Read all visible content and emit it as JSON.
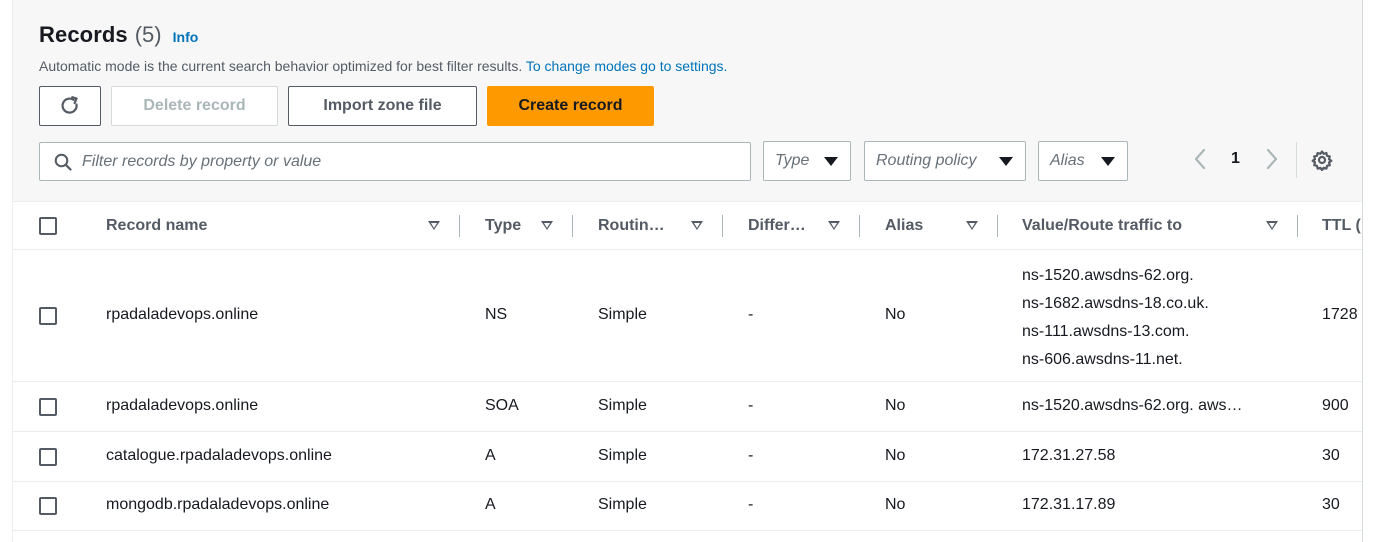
{
  "header": {
    "title": "Records",
    "count": "(5)",
    "info_link": "Info",
    "description": "Automatic mode is the current search behavior optimized for best filter results.",
    "description_link": "To change modes go to settings."
  },
  "toolbar": {
    "refresh_icon": "refresh-icon",
    "delete_label": "Delete record",
    "import_label": "Import zone file",
    "create_label": "Create record",
    "create_color": "#ff9900"
  },
  "filters": {
    "search_placeholder": "Filter records by property or value",
    "type_label": "Type",
    "routing_label": "Routing policy",
    "alias_label": "Alias"
  },
  "pagination": {
    "current_page": "1"
  },
  "table": {
    "columns": [
      "Record name",
      "Type",
      "Routin…",
      "Differ…",
      "Alias",
      "Value/Route traffic to",
      "TTL ("
    ],
    "rows": [
      {
        "name": "rpadaladevops.online",
        "type": "NS",
        "routing": "Simple",
        "differ": "-",
        "alias": "No",
        "values": [
          "ns-1520.awsdns-62.org.",
          "ns-1682.awsdns-18.co.uk.",
          "ns-111.awsdns-13.com.",
          "ns-606.awsdns-11.net."
        ],
        "ttl": "1728"
      },
      {
        "name": "rpadaladevops.online",
        "type": "SOA",
        "routing": "Simple",
        "differ": "-",
        "alias": "No",
        "value": "ns-1520.awsdns-62.org. aws…",
        "ttl": "900"
      },
      {
        "name": "catalogue.rpadaladevops.online",
        "type": "A",
        "routing": "Simple",
        "differ": "-",
        "alias": "No",
        "value": "172.31.27.58",
        "ttl": "30"
      },
      {
        "name": "mongodb.rpadaladevops.online",
        "type": "A",
        "routing": "Simple",
        "differ": "-",
        "alias": "No",
        "value": "172.31.17.89",
        "ttl": "30"
      }
    ]
  }
}
